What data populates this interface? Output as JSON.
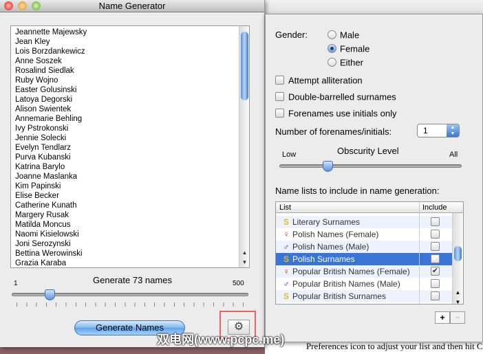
{
  "window": {
    "title": "Name Generator"
  },
  "names": [
    "Jeannette Majewsky",
    "Jean Kley",
    "Lois Borzdankewicz",
    "Anne Soszek",
    "Rosalind Siedlak",
    "Ruby Wojno",
    "Easter Golusinski",
    "Latoya Degorski",
    "Alison Swientek",
    "Annemarie Behling",
    "Ivy Pstrokonski",
    "Jennie Solecki",
    "Evelyn Tendlarz",
    "Purva Kubanski",
    "Katrina Barylo",
    "Joanne Maslanka",
    "Kim Papinski",
    "Elise Becker",
    "Catherine Kunath",
    "Margery Rusak",
    "Matilda Moncus",
    "Naomi Kisielowski",
    "Joni Serozynski",
    "Bettina Werowinski",
    "Grazia Karaba"
  ],
  "count_slider": {
    "label": "Generate 73 names",
    "min_label": "1",
    "max_label": "500",
    "min": 1,
    "max": 500,
    "value": 73
  },
  "generate_button": "Generate Names",
  "watermark": "双电网(www.pcpc.me)",
  "background_doc_text": "Preferences icon to adjust your list and then hit C",
  "prefs": {
    "gender_label": "Gender:",
    "gender_options": [
      "Male",
      "Female",
      "Either"
    ],
    "gender_selected": "Female",
    "checkboxes": [
      {
        "label": "Attempt alliteration",
        "checked": false
      },
      {
        "label": "Double-barrelled surnames",
        "checked": false
      },
      {
        "label": "Forenames use initials only",
        "checked": false
      }
    ],
    "forenames_label": "Number of forenames/initials:",
    "forenames_value": "1",
    "obscurity": {
      "title": "Obscurity Level",
      "low": "Low",
      "high": "All",
      "value": 0.25
    },
    "lists_label": "Name lists to include in name generation:",
    "table_headers": [
      "List",
      "Include"
    ],
    "lists": [
      {
        "icon": "S",
        "type": "surname",
        "name": "Literary Surnames",
        "include": false,
        "selected": false
      },
      {
        "icon": "♀",
        "type": "female",
        "name": "Polish Names (Female)",
        "include": false,
        "selected": false
      },
      {
        "icon": "♂",
        "type": "male",
        "name": "Polish Names (Male)",
        "include": false,
        "selected": false
      },
      {
        "icon": "S",
        "type": "surname",
        "name": "Polish Surnames",
        "include": true,
        "selected": true
      },
      {
        "icon": "♀",
        "type": "female",
        "name": "Popular British Names (Female)",
        "include": true,
        "selected": false
      },
      {
        "icon": "♂",
        "type": "male",
        "name": "Popular British Names (Male)",
        "include": false,
        "selected": false
      },
      {
        "icon": "S",
        "type": "surname",
        "name": "Popular British Surnames",
        "include": false,
        "selected": false
      }
    ],
    "add_label": "+",
    "remove_label": "−"
  },
  "colors": {
    "female": "#e0101a",
    "male": "#2233bb",
    "surname": "#e8b820",
    "selection": "#3875d7"
  }
}
